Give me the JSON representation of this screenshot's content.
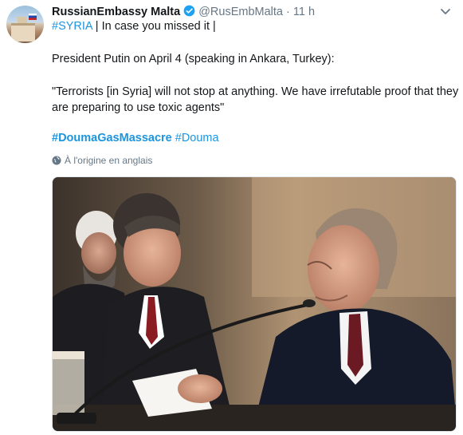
{
  "tweet": {
    "display_name": "RussianEmbassy Malta",
    "handle": "@RusEmbMalta",
    "separator": "·",
    "time": "11 h",
    "line1_hashtag": "#SYRIA",
    "line1_rest": " | In case you missed it |",
    "paragraph1": "President Putin on April 4 (speaking in Ankara, Turkey):",
    "quote_line1": "\"Terrorists [in Syria] will not stop at anything. We have irrefutable proof that they",
    "quote_line2": "are preparing to use toxic agents\"",
    "hashtag_main": "#DoumaGasMassacre",
    "hashtag_second": "#Douma",
    "translated_label": "À l'origine en anglais"
  },
  "icons": {
    "verified": "verified-badge-icon",
    "menu": "chevron-down-icon",
    "globe": "globe-icon"
  },
  "colors": {
    "link": "#1b95e0",
    "secondary": "#657786",
    "text": "#14171a"
  }
}
